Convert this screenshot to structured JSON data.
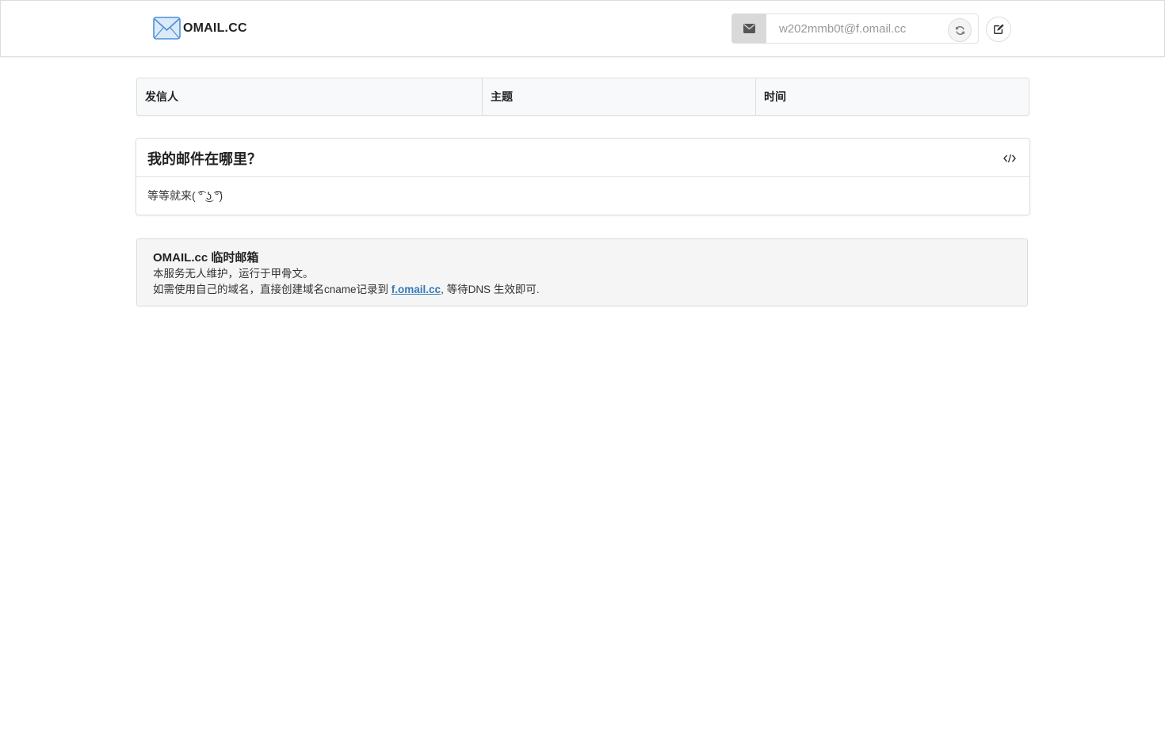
{
  "navbar": {
    "brand_text": "OMAIL.CC",
    "logo_icon": "envelope-logo-icon",
    "address_addon_icon": "envelope-icon",
    "address_value": "w202mmb0t@f.omail.cc",
    "refresh_icon": "refresh-icon",
    "edit_icon": "edit-icon"
  },
  "mail_table": {
    "headers": [
      "发信人",
      "主题",
      "时间"
    ]
  },
  "panel": {
    "title": "我的邮件在哪里？",
    "code_icon": "code-icon",
    "body": "等等就来( ͡° ͜ʖ ͡°)"
  },
  "info": {
    "title": "OMAIL.cc 临时邮箱",
    "line1": "本服务无人维护，运行于甲骨文。",
    "line2_prefix": "如需使用自己的域名，直接创建域名cname记录到 ",
    "link_text": "f.omail.cc",
    "line2_suffix": ", 等待DNS 生效即可."
  },
  "colors": {
    "link": "#337ab7",
    "addon_bg": "#d9d9d9",
    "table_header_bg": "#f8f9fa",
    "well_bg": "#f5f5f5",
    "logo_blue": "#4a90d9"
  }
}
